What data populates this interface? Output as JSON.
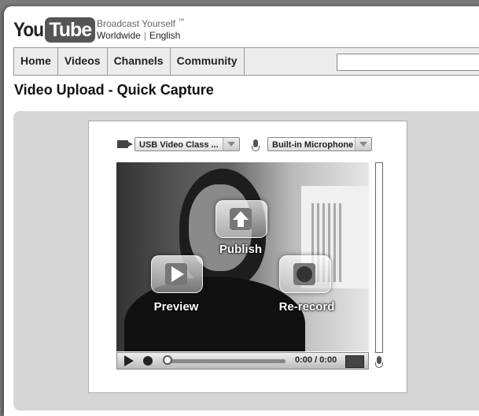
{
  "brand": {
    "logo_you": "You",
    "logo_tube": "Tube",
    "tagline": "Broadcast Yourself",
    "trademark": "™",
    "region": "Worldwide",
    "language": "English"
  },
  "nav": {
    "items": [
      {
        "label": "Home"
      },
      {
        "label": "Videos"
      },
      {
        "label": "Channels"
      },
      {
        "label": "Community"
      }
    ],
    "search_value": ""
  },
  "page": {
    "title": "Video Upload - Quick Capture"
  },
  "capture": {
    "camera_select": "USB Video Class ...",
    "mic_select": "Built-in Microphone",
    "buttons": {
      "publish": "Publish",
      "preview": "Preview",
      "rerecord": "Re-record"
    },
    "time": "0:00 / 0:00",
    "progress": 0
  }
}
